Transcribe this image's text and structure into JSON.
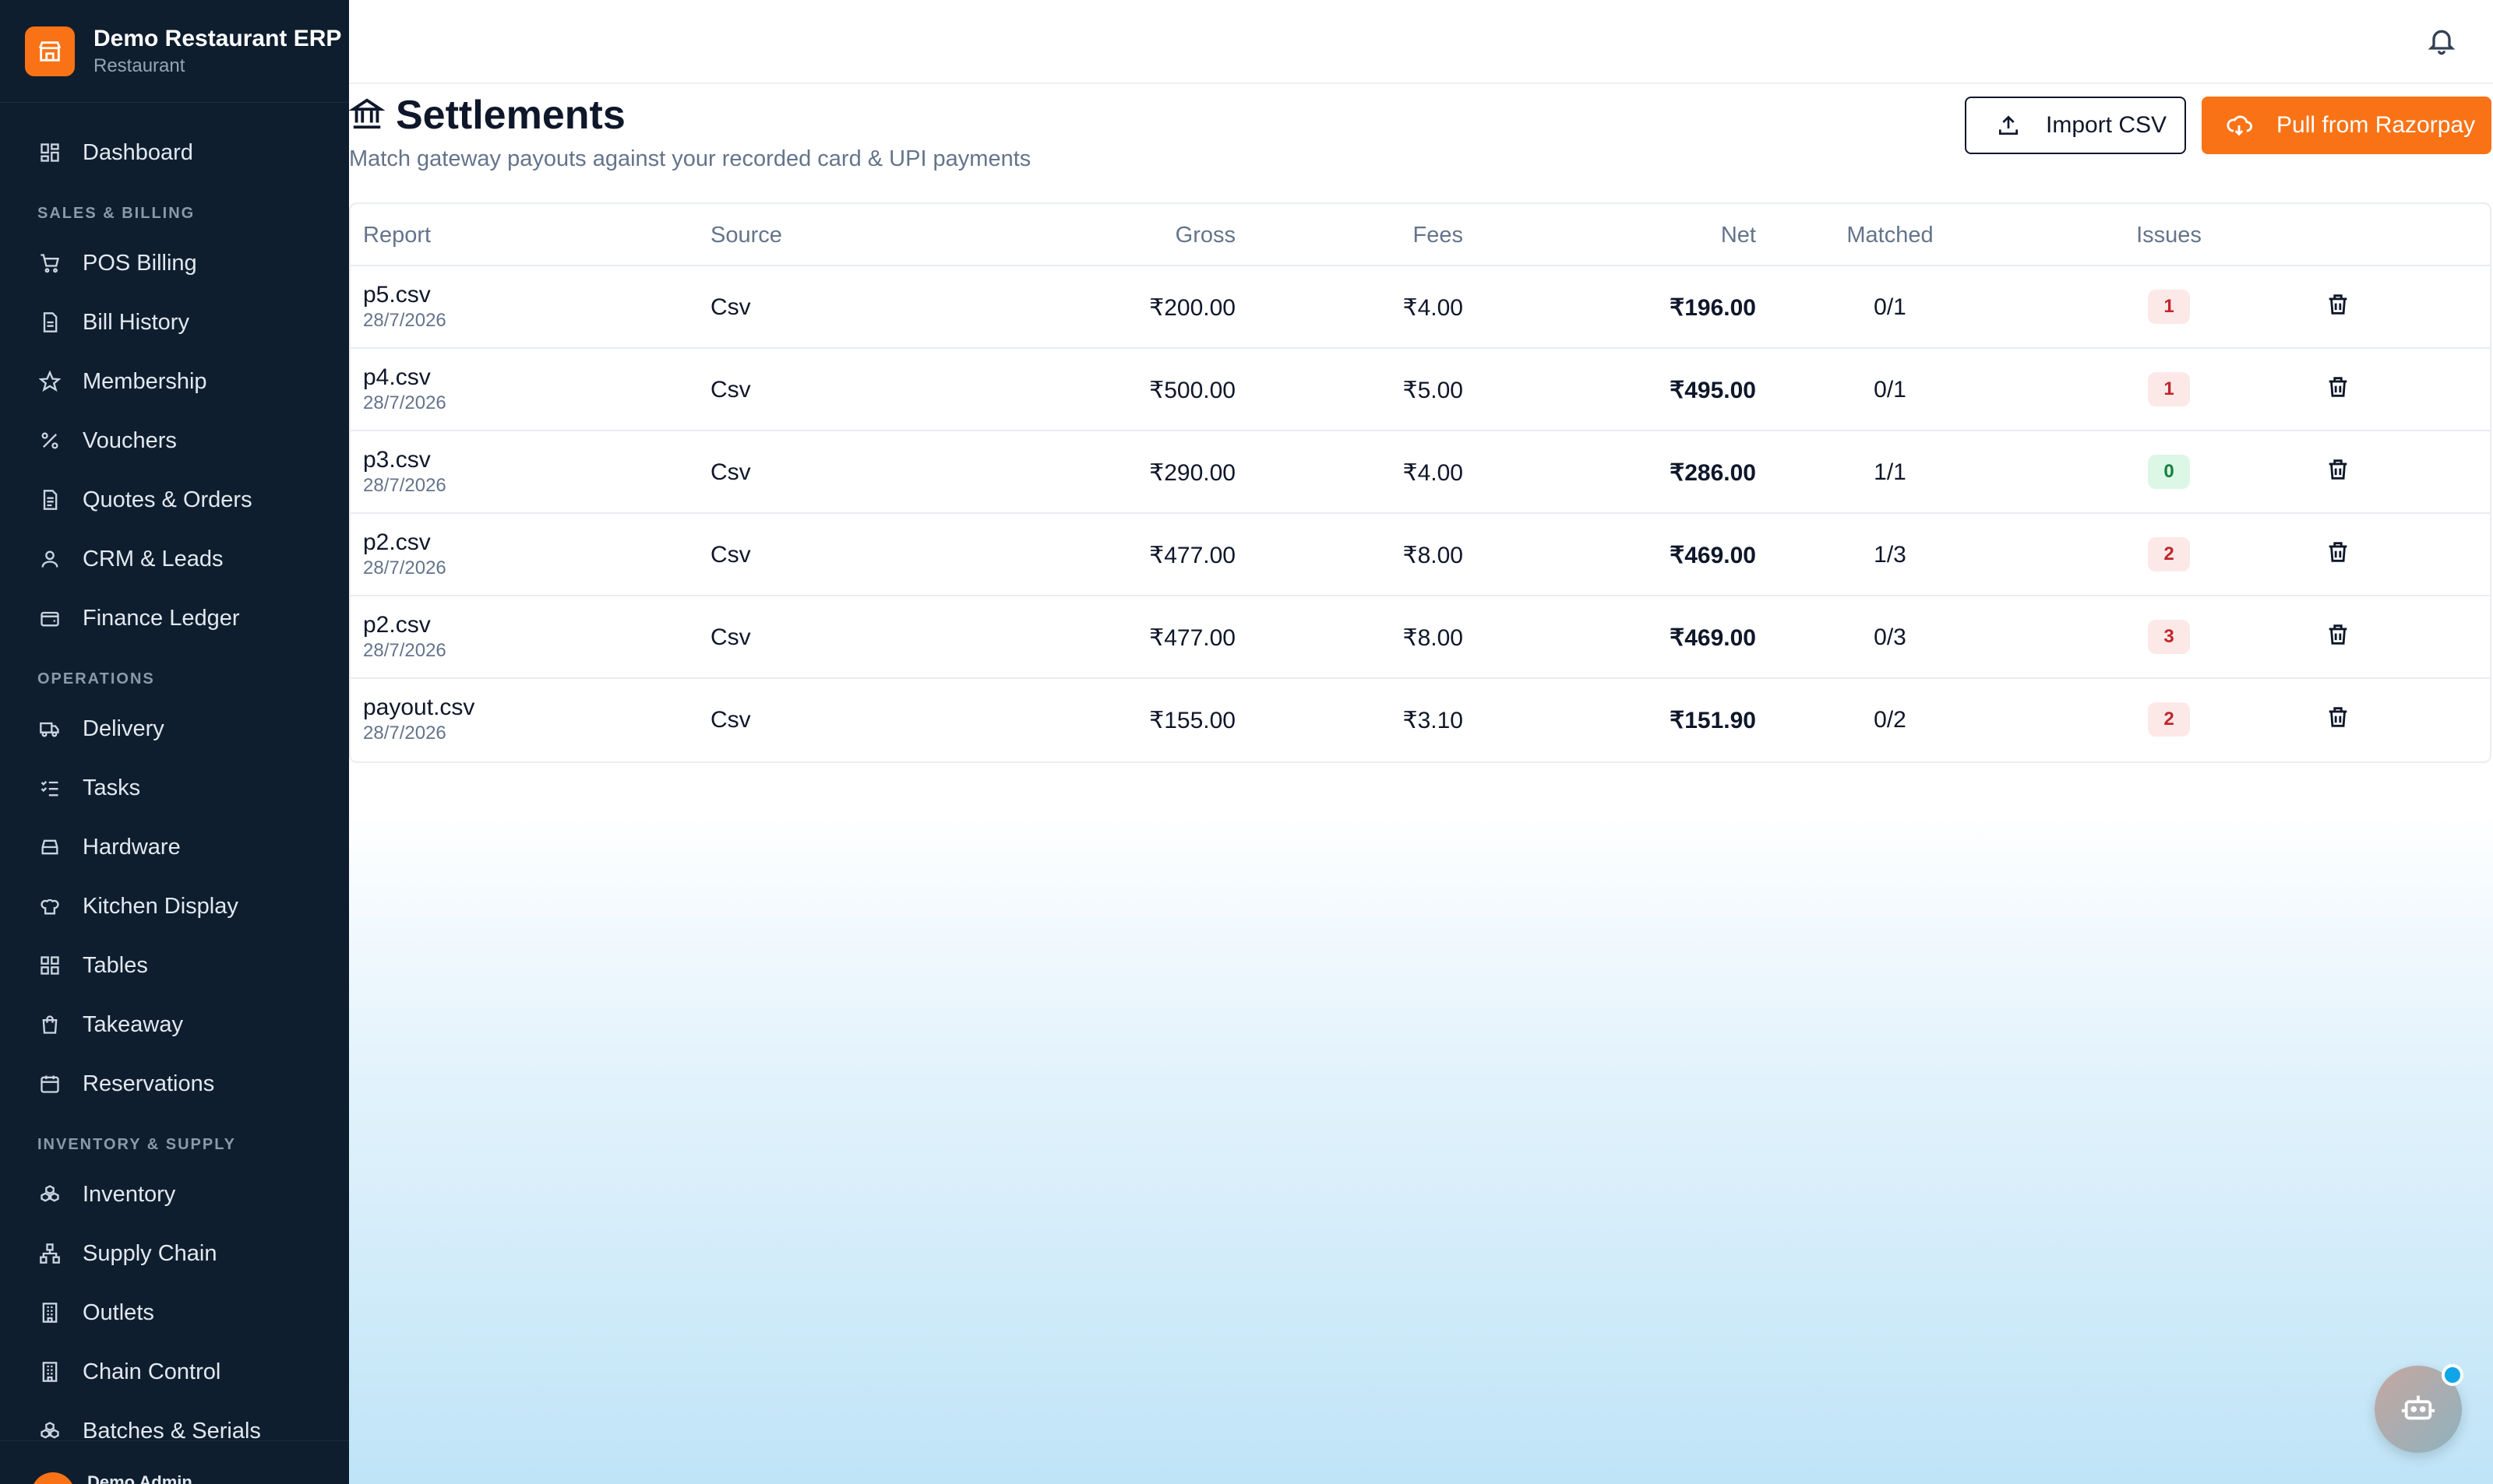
{
  "brand": {
    "name": "Demo Restaurant ERP",
    "subtitle": "Restaurant"
  },
  "sidebar": {
    "dashboard": "Dashboard",
    "sections": [
      {
        "title": "SALES & BILLING",
        "items": [
          {
            "label": "POS Billing",
            "icon": "cart-icon"
          },
          {
            "label": "Bill History",
            "icon": "receipt-icon"
          },
          {
            "label": "Membership",
            "icon": "star-icon"
          },
          {
            "label": "Vouchers",
            "icon": "percent-icon"
          },
          {
            "label": "Quotes & Orders",
            "icon": "document-icon"
          },
          {
            "label": "CRM & Leads",
            "icon": "user-icon"
          },
          {
            "label": "Finance Ledger",
            "icon": "wallet-icon"
          }
        ]
      },
      {
        "title": "OPERATIONS",
        "items": [
          {
            "label": "Delivery",
            "icon": "truck-icon"
          },
          {
            "label": "Tasks",
            "icon": "checklist-icon"
          },
          {
            "label": "Hardware",
            "icon": "hard-drive-icon"
          },
          {
            "label": "Kitchen Display",
            "icon": "chef-hat-icon"
          },
          {
            "label": "Tables",
            "icon": "grid-icon"
          },
          {
            "label": "Takeaway",
            "icon": "bag-icon"
          },
          {
            "label": "Reservations",
            "icon": "calendar-icon"
          }
        ]
      },
      {
        "title": "INVENTORY & SUPPLY",
        "items": [
          {
            "label": "Inventory",
            "icon": "boxes-icon"
          },
          {
            "label": "Supply Chain",
            "icon": "network-icon"
          },
          {
            "label": "Outlets",
            "icon": "building-icon"
          },
          {
            "label": "Chain Control",
            "icon": "building-icon"
          },
          {
            "label": "Batches & Serials",
            "icon": "boxes-icon"
          }
        ]
      }
    ],
    "user": "Demo Admin"
  },
  "page": {
    "title": "Settlements",
    "subtitle": "Match gateway payouts against your recorded card & UPI payments",
    "import_label": "Import CSV",
    "pull_label": "Pull from Razorpay"
  },
  "table": {
    "headers": [
      "Report",
      "Source",
      "Gross",
      "Fees",
      "Net",
      "Matched",
      "Issues"
    ],
    "rows": [
      {
        "report": "p5.csv",
        "date": "28/7/2026",
        "source": "Csv",
        "gross": "₹200.00",
        "fees": "₹4.00",
        "net": "₹196.00",
        "matched": "0/1",
        "issues": "1",
        "status": "red"
      },
      {
        "report": "p4.csv",
        "date": "28/7/2026",
        "source": "Csv",
        "gross": "₹500.00",
        "fees": "₹5.00",
        "net": "₹495.00",
        "matched": "0/1",
        "issues": "1",
        "status": "red"
      },
      {
        "report": "p3.csv",
        "date": "28/7/2026",
        "source": "Csv",
        "gross": "₹290.00",
        "fees": "₹4.00",
        "net": "₹286.00",
        "matched": "1/1",
        "issues": "0",
        "status": "green"
      },
      {
        "report": "p2.csv",
        "date": "28/7/2026",
        "source": "Csv",
        "gross": "₹477.00",
        "fees": "₹8.00",
        "net": "₹469.00",
        "matched": "1/3",
        "issues": "2",
        "status": "red"
      },
      {
        "report": "p2.csv",
        "date": "28/7/2026",
        "source": "Csv",
        "gross": "₹477.00",
        "fees": "₹8.00",
        "net": "₹469.00",
        "matched": "0/3",
        "issues": "3",
        "status": "red"
      },
      {
        "report": "payout.csv",
        "date": "28/7/2026",
        "source": "Csv",
        "gross": "₹155.00",
        "fees": "₹3.10",
        "net": "₹151.90",
        "matched": "0/2",
        "issues": "2",
        "status": "red"
      }
    ]
  },
  "colors": {
    "accent": "#f97316",
    "sidebar_bg": "#0f1e2e",
    "issue_red": "#c0262d",
    "issue_green": "#15803d"
  }
}
